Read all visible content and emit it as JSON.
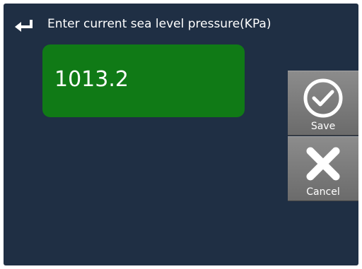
{
  "header": {
    "back_icon": "return-arrow-icon",
    "title": "Enter current sea level pressure(KPa)"
  },
  "input": {
    "value": "1013.2"
  },
  "actions": {
    "save": {
      "label": "Save",
      "icon": "checkmark-circle-icon"
    },
    "cancel": {
      "label": "Cancel",
      "icon": "x-icon"
    }
  },
  "colors": {
    "background": "#1f2f44",
    "input_fill": "#107a16",
    "button_fill": "#7b7b7b",
    "text": "#ffffff"
  }
}
